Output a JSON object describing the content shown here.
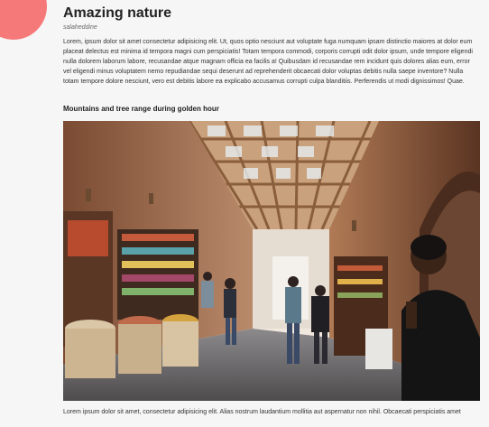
{
  "menu": {
    "icon": "hamburger-menu-icon",
    "color": "#f6797a"
  },
  "article": {
    "title": "Amazing nature",
    "author": "salaheddine",
    "body": "Lorem, ipsum dolor sit amet consectetur adipisicing elit. Ut, quos optio nesciunt aut voluptate fuga numquam ipsam distinctio maiores at dolor eum placeat delectus est minima id tempora magni cum perspiciatis! Totam tempora commodi, corporis corrupti odit dolor ipsum, unde tempore eligendi nulla dolorem laborum labore, recusandae atque magnam officia ea facilis a! Quibusdam id recusandae rem incidunt quis dolores alias eum, error vel eligendi minus voluptatem nemo repudiandae sequi deserunt ad reprehenderit obcaecati dolor voluptas debitis nulla saepe inventore? Nulla totam tempore dolore nesciunt, vero est debitis labore ea explicabo accusamus corrupti culpa blanditiis. Perferendis ut modi dignissimos! Quae.",
    "subheading": "Mountains and tree range during golden hour",
    "caption": "Lorem ipsum dolor sit amet, consectetur adipisicing elit. Alias nostrum laudantium mollitia aut aspernatur non nihil. Obcaecati perspiciatis amet"
  }
}
